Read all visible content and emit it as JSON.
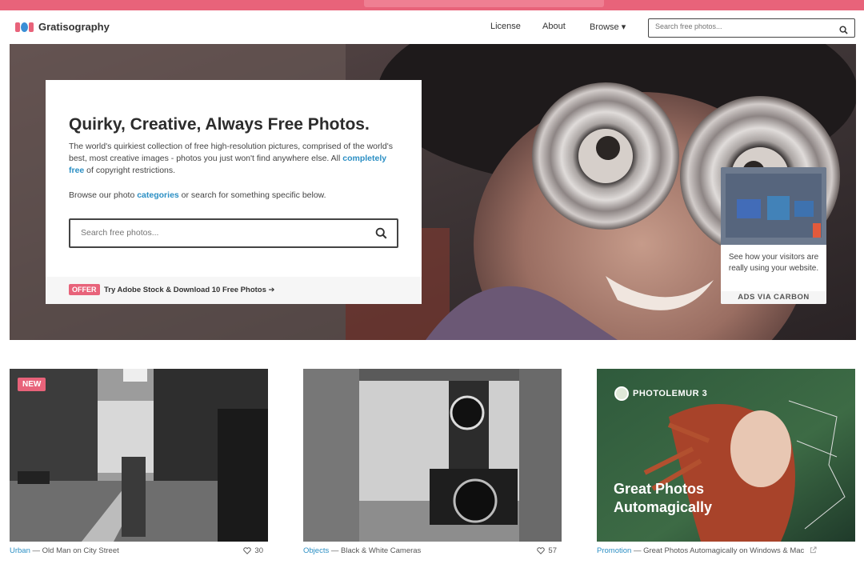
{
  "nav": {
    "brand": "Gratisography",
    "links": [
      "License",
      "About",
      "Browse ▾"
    ],
    "search_placeholder": "Search free photos..."
  },
  "hero": {
    "title": "Quirky, Creative, Always Free Photos.",
    "desc_1": "The world's quirkiest collection of free high-resolution pictures, comprised of the world's best, most creative images - photos you just won't find anywhere else. All ",
    "desc_link": "completely free",
    "desc_2": " of copyright restrictions.",
    "browse_1": "Browse our photo ",
    "browse_link": "categories",
    "browse_2": " or search for something specific below.",
    "search_placeholder": "Search free photos...",
    "offer_badge": "OFFER",
    "offer_text": "Try Adobe Stock & Download 10 Free Photos ➔"
  },
  "carbon_ad": {
    "copy": "See how your visitors are really using your website.",
    "via": "ADS VIA CARBON"
  },
  "photos": [
    {
      "badge": "NEW",
      "category": "Urban",
      "title": " — Old Man on City Street",
      "likes": "30"
    },
    {
      "category": "Objects",
      "title": " — Black & White Cameras",
      "likes": "57"
    },
    {
      "category": "Promotion",
      "title": " — Great Photos Automagically on Windows & Mac",
      "promo_brand": "PHOTOLEMUR 3",
      "promo_line1": "Great Photos",
      "promo_line2": "Automagically"
    }
  ],
  "colors": {
    "brand": "#e8637a",
    "link": "#2b8fc4"
  }
}
